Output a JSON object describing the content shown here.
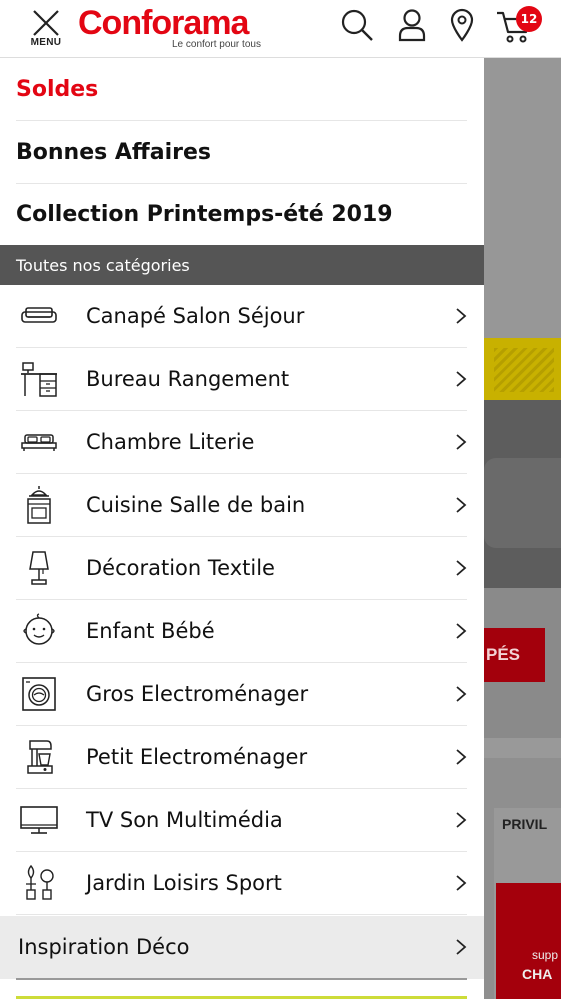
{
  "header": {
    "menu_label": "MENU",
    "logo_text": "Conforama",
    "logo_tagline": "Le confort pour tous",
    "cart_count": "12",
    "icons": [
      "close-icon",
      "search-icon",
      "user-icon",
      "location-pin-icon",
      "cart-icon"
    ],
    "brand_color": "#e30613"
  },
  "drawer": {
    "promos": [
      {
        "label": "Soldes",
        "color": "#e30613"
      },
      {
        "label": "Bonnes Affaires"
      },
      {
        "label": "Collection Printemps-été 2019"
      }
    ],
    "section_title": "Toutes nos catégories",
    "categories": [
      {
        "label": "Canapé Salon Séjour",
        "icon": "sofa-icon"
      },
      {
        "label": "Bureau Rangement",
        "icon": "desk-icon"
      },
      {
        "label": "Chambre Literie",
        "icon": "bed-icon"
      },
      {
        "label": "Cuisine Salle de bain",
        "icon": "stove-icon"
      },
      {
        "label": "Décoration Textile",
        "icon": "lamp-icon"
      },
      {
        "label": "Enfant Bébé",
        "icon": "baby-face-icon"
      },
      {
        "label": "Gros Electroménager",
        "icon": "washing-machine-icon"
      },
      {
        "label": "Petit Electroménager",
        "icon": "mixer-icon"
      },
      {
        "label": "TV Son Multimédia",
        "icon": "tv-icon"
      },
      {
        "label": "Jardin Loisirs Sport",
        "icon": "garden-tools-icon"
      }
    ],
    "inspiration_label": "Inspiration Déco"
  },
  "background_page": {
    "banner_partial_text": "PÉS",
    "card_title_partial": "PRIVIL",
    "card_text_1": "supp",
    "card_text_2": "CHA"
  }
}
